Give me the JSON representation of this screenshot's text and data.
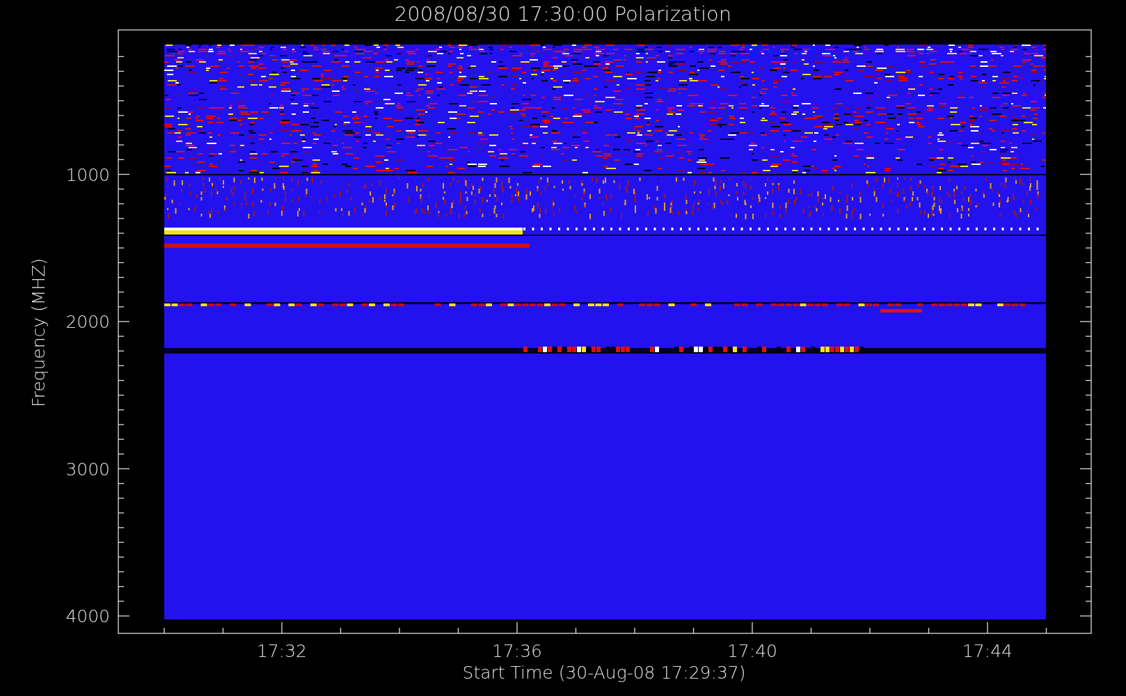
{
  "title": "2008/08/30 17:30:00 Polarization",
  "y_axis": {
    "label": "Frequency (MHZ)",
    "ticks": [
      "1000",
      "2000",
      "3000",
      "4000"
    ]
  },
  "x_axis": {
    "label": "Start Time (30-Aug-08 17:29:37)",
    "ticks": [
      "17:32",
      "17:36",
      "17:40",
      "17:44"
    ]
  }
}
